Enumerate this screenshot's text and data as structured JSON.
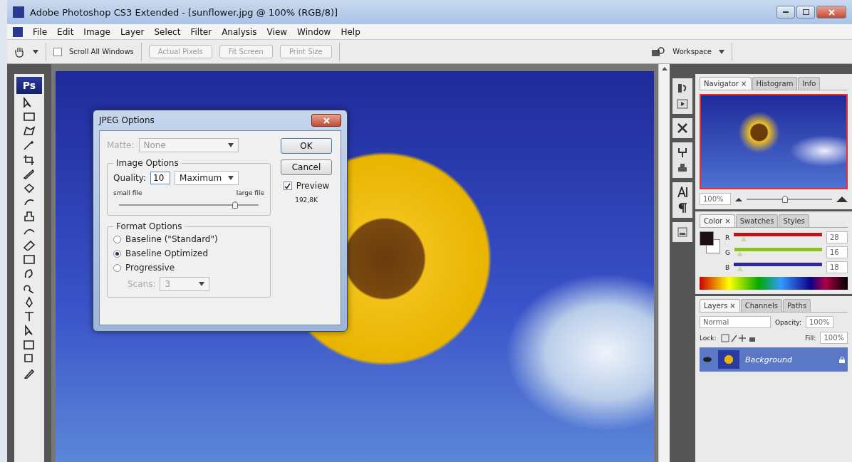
{
  "window": {
    "title": "Adobe Photoshop CS3 Extended - [sunflower.jpg @ 100% (RGB/8)]"
  },
  "menu": [
    {
      "label": "File"
    },
    {
      "label": "Edit"
    },
    {
      "label": "Image"
    },
    {
      "label": "Layer"
    },
    {
      "label": "Select"
    },
    {
      "label": "Filter"
    },
    {
      "label": "Analysis"
    },
    {
      "label": "View"
    },
    {
      "label": "Window"
    },
    {
      "label": "Help"
    }
  ],
  "options_bar": {
    "scroll_all": {
      "label": "Scroll All Windows",
      "checked": false
    },
    "buttons": [
      "Actual Pixels",
      "Fit Screen",
      "Print Size"
    ],
    "workspace": "Workspace"
  },
  "toolbox": {
    "logo": "Ps"
  },
  "dialog": {
    "title": "JPEG Options",
    "matte": {
      "label": "Matte:",
      "value": "None",
      "disabled": true
    },
    "image_options": {
      "legend": "Image Options",
      "quality_label": "Quality:",
      "quality": "10",
      "preset": "Maximum",
      "min_label": "small file",
      "max_label": "large file",
      "level": 0.83
    },
    "format_options": {
      "legend": "Format Options",
      "choices": [
        {
          "label": "Baseline (\"Standard\")",
          "selected": false
        },
        {
          "label": "Baseline Optimized",
          "selected": true
        },
        {
          "label": "Progressive",
          "selected": false
        }
      ],
      "scans": {
        "label": "Scans:",
        "value": "3",
        "disabled": true
      }
    },
    "buttons": [
      "OK",
      "Cancel"
    ],
    "preview": {
      "label": "Preview",
      "checked": true
    },
    "size": "192,8K"
  },
  "navigator": {
    "tabs": [
      {
        "label": "Navigator ×",
        "selected": true
      },
      {
        "label": "Histogram",
        "selected": false
      },
      {
        "label": "Info",
        "selected": false
      }
    ],
    "zoom": "100%",
    "level": 0.45
  },
  "color": {
    "tabs": [
      {
        "label": "Color ×",
        "selected": true
      },
      {
        "label": "Swatches",
        "selected": false
      },
      {
        "label": "Styles",
        "selected": false
      }
    ],
    "channels": [
      {
        "label": "R",
        "value": "28",
        "level": 0.11,
        "color": "#c0141a"
      },
      {
        "label": "G",
        "value": "16",
        "level": 0.06,
        "color": "#8cc21e"
      },
      {
        "label": "B",
        "value": "18",
        "level": 0.07,
        "color": "#2a2a9a"
      }
    ]
  },
  "layers": {
    "tabs": [
      {
        "label": "Layers ×",
        "selected": true
      },
      {
        "label": "Channels",
        "selected": false
      },
      {
        "label": "Paths",
        "selected": false
      }
    ],
    "blend": "Normal",
    "opacity_label": "Opacity:",
    "opacity": "100%",
    "lock_label": "Lock:",
    "fill_label": "Fill:",
    "fill": "100%",
    "items": [
      {
        "name": "Background",
        "selected": true
      }
    ]
  }
}
